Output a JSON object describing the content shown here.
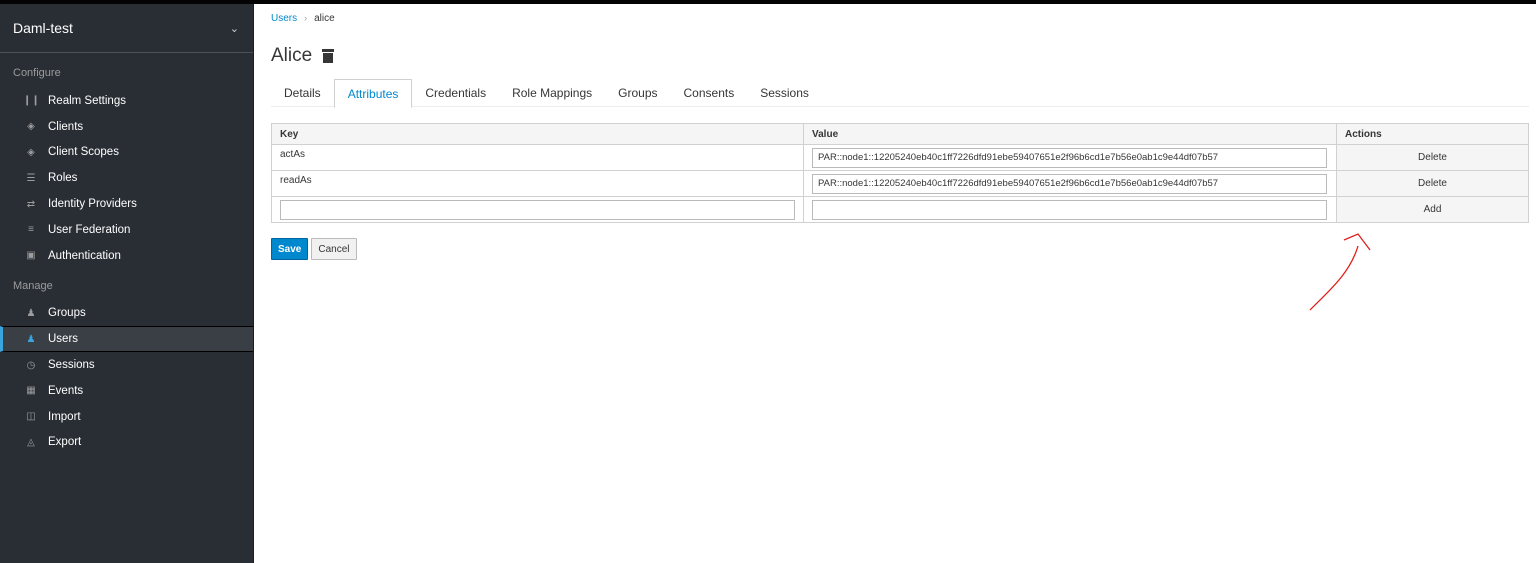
{
  "sidebar": {
    "realm": "Daml-test",
    "configure_label": "Configure",
    "configure_items": [
      {
        "label": "Realm Settings",
        "icon": "sliders-icon"
      },
      {
        "label": "Clients",
        "icon": "cube-icon"
      },
      {
        "label": "Client Scopes",
        "icon": "cubes-icon"
      },
      {
        "label": "Roles",
        "icon": "list-icon"
      },
      {
        "label": "Identity Providers",
        "icon": "exchange-icon"
      },
      {
        "label": "User Federation",
        "icon": "database-icon"
      },
      {
        "label": "Authentication",
        "icon": "lock-icon"
      }
    ],
    "manage_label": "Manage",
    "manage_items": [
      {
        "label": "Groups",
        "icon": "users-icon"
      },
      {
        "label": "Users",
        "icon": "user-icon",
        "active": true
      },
      {
        "label": "Sessions",
        "icon": "clock-icon"
      },
      {
        "label": "Events",
        "icon": "calendar-icon"
      },
      {
        "label": "Import",
        "icon": "import-icon"
      },
      {
        "label": "Export",
        "icon": "export-icon"
      }
    ]
  },
  "breadcrumb": {
    "parent": "Users",
    "current": "alice"
  },
  "page_title": "Alice",
  "tabs": [
    "Details",
    "Attributes",
    "Credentials",
    "Role Mappings",
    "Groups",
    "Consents",
    "Sessions"
  ],
  "active_tab": "Attributes",
  "table": {
    "headers": {
      "key": "Key",
      "value": "Value",
      "actions": "Actions"
    },
    "rows": [
      {
        "key": "actAs",
        "value": "PAR::node1::12205240eb40c1ff7226dfd91ebe59407651e2f96b6cd1e7b56e0ab1c9e44df07b57",
        "action": "Delete"
      },
      {
        "key": "readAs",
        "value": "PAR::node1::12205240eb40c1ff7226dfd91ebe59407651e2f96b6cd1e7b56e0ab1c9e44df07b57",
        "action": "Delete"
      }
    ],
    "new_row": {
      "key": "",
      "value": "",
      "action": "Add"
    }
  },
  "buttons": {
    "save": "Save",
    "cancel": "Cancel"
  },
  "colors": {
    "sidebar_bg": "#292e34",
    "accent": "#0088ce",
    "annotation": "#e0201b"
  }
}
